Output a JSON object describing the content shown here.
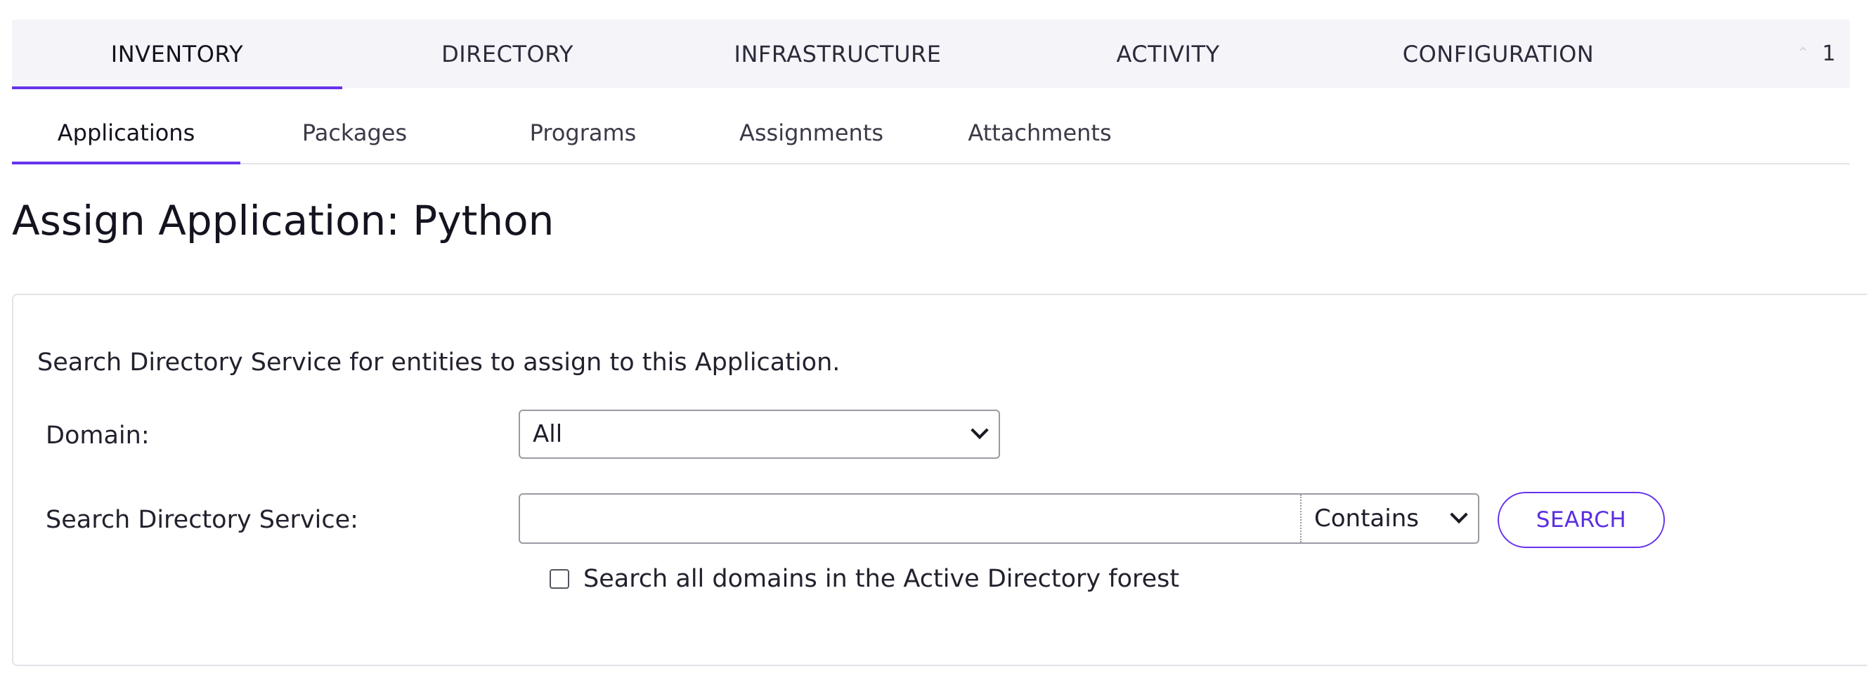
{
  "topnav": {
    "tabs": [
      {
        "label": "INVENTORY",
        "active": true
      },
      {
        "label": "DIRECTORY",
        "active": false
      },
      {
        "label": "INFRASTRUCTURE",
        "active": false
      },
      {
        "label": "ACTIVITY",
        "active": false
      },
      {
        "label": "CONFIGURATION",
        "active": false
      }
    ],
    "overflow_count": "1"
  },
  "subnav": {
    "tabs": [
      {
        "label": "Applications",
        "active": true
      },
      {
        "label": "Packages",
        "active": false
      },
      {
        "label": "Programs",
        "active": false
      },
      {
        "label": "Assignments",
        "active": false
      },
      {
        "label": "Attachments",
        "active": false
      }
    ]
  },
  "page": {
    "title": "Assign Application: Python"
  },
  "form": {
    "description": "Search Directory Service for entities to assign to this Application.",
    "domain": {
      "label": "Domain:",
      "selected": "All"
    },
    "search": {
      "label": "Search Directory Service:",
      "value": "",
      "placeholder": "",
      "match_mode": "Contains",
      "button_label": "SEARCH"
    },
    "all_domains_checkbox": {
      "label": "Search all domains in the Active Directory forest",
      "checked": false
    }
  },
  "colors": {
    "accent": "#6633ee",
    "nav_background": "#f4f4f9"
  }
}
